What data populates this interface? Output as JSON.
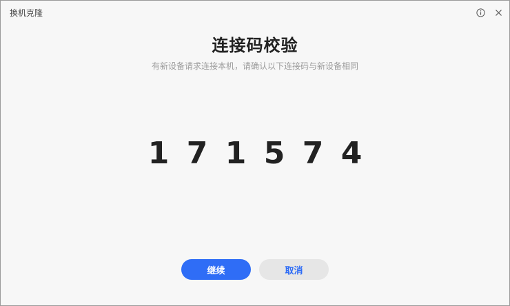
{
  "window": {
    "title": "换机克隆"
  },
  "dialog": {
    "title": "连接码校验",
    "subtitle": "有新设备请求连接本机，请确认以下连接码与新设备相同",
    "code_digits": [
      "1",
      "7",
      "1",
      "5",
      "7",
      "4"
    ]
  },
  "actions": {
    "continue_label": "继续",
    "cancel_label": "取消"
  },
  "titlebar_icons": [
    "info-icon",
    "close-icon"
  ],
  "colors": {
    "primary": "#2f6df6",
    "background": "#f7f7f7",
    "secondary_button": "#e6e6e6"
  }
}
